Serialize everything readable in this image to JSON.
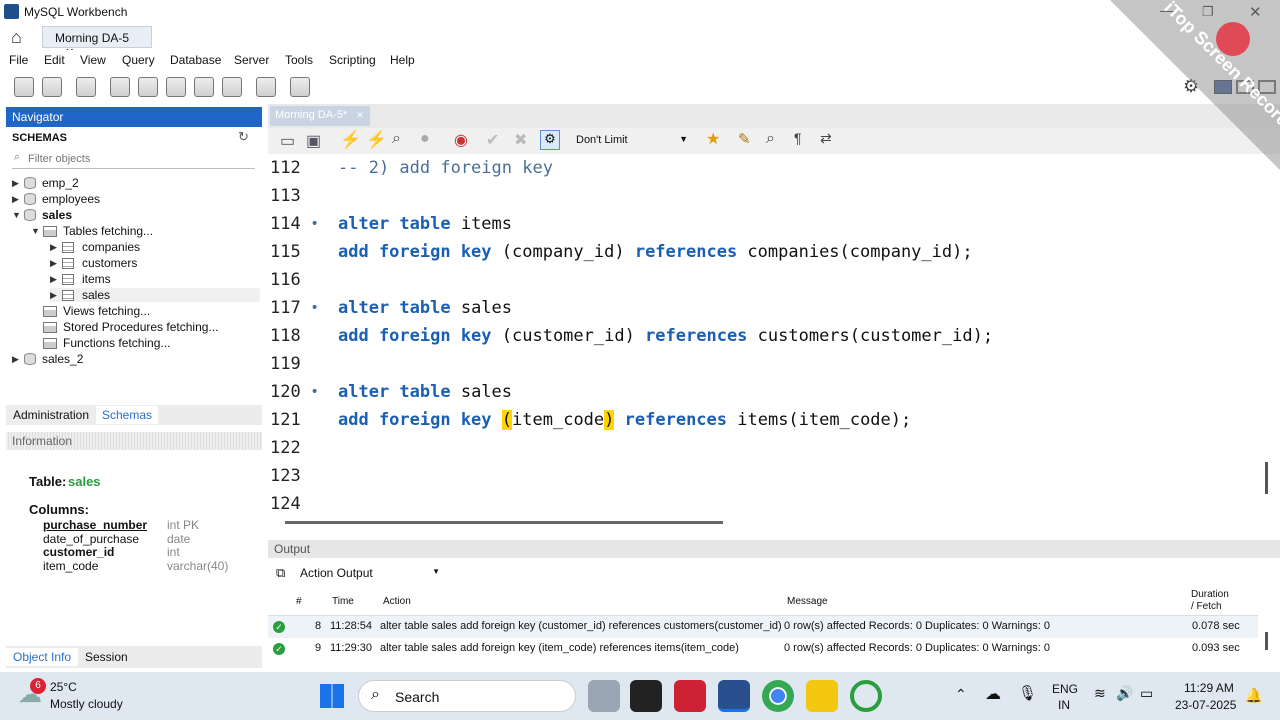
{
  "window": {
    "title": "MySQL Workbench",
    "tab_label": "Morning DA-5"
  },
  "watermark": {
    "text": "iTop Screen Recorder"
  },
  "menu": [
    "File",
    "Edit",
    "View",
    "Query",
    "Database",
    "Server",
    "Tools",
    "Scripting",
    "Help"
  ],
  "navigator": {
    "header": "Navigator",
    "schemas_label": "SCHEMAS",
    "filter_placeholder": "Filter objects",
    "tree": [
      {
        "label": "emp_2",
        "level": 0,
        "arrow": "▶",
        "kind": "db"
      },
      {
        "label": "employees",
        "level": 0,
        "arrow": "▶",
        "kind": "db"
      },
      {
        "label": "sales",
        "level": 0,
        "arrow": "▼",
        "kind": "db",
        "bold": true
      },
      {
        "label": "Tables fetching...",
        "level": 1,
        "arrow": "▼",
        "kind": "folder"
      },
      {
        "label": "companies",
        "level": 2,
        "arrow": "▶",
        "kind": "table"
      },
      {
        "label": "customers",
        "level": 2,
        "arrow": "▶",
        "kind": "table"
      },
      {
        "label": "items",
        "level": 2,
        "arrow": "▶",
        "kind": "table"
      },
      {
        "label": "sales",
        "level": 2,
        "arrow": "▶",
        "kind": "table",
        "selected": true
      },
      {
        "label": "Views fetching...",
        "level": 1,
        "arrow": "",
        "kind": "folder"
      },
      {
        "label": "Stored Procedures fetching...",
        "level": 1,
        "arrow": "",
        "kind": "folder"
      },
      {
        "label": "Functions fetching...",
        "level": 1,
        "arrow": "",
        "kind": "folder"
      },
      {
        "label": "sales_2",
        "level": 0,
        "arrow": "▶",
        "kind": "db"
      }
    ],
    "bottom_tabs": [
      "Administration",
      "Schemas"
    ]
  },
  "info": {
    "header": "Information",
    "table_label": "Table:",
    "table_name": "sales",
    "columns_label": "Columns:",
    "columns": [
      {
        "name": "purchase_number",
        "type": "int PK",
        "key": true
      },
      {
        "name": "date_of_purchase",
        "type": "date",
        "key": false
      },
      {
        "name": "customer_id",
        "type": "int",
        "key": true
      },
      {
        "name": "item_code",
        "type": "varchar(40)",
        "key": false
      }
    ],
    "bottom_tabs": [
      "Object Info",
      "Session"
    ]
  },
  "editor": {
    "tab_label": "Morning DA-5*",
    "limit_select": "Don't Limit",
    "lines": [
      {
        "n": "112",
        "dot": false,
        "parts": [
          {
            "t": "-- 2) add foreign key",
            "c": "cm"
          }
        ]
      },
      {
        "n": "113",
        "dot": false,
        "parts": []
      },
      {
        "n": "114",
        "dot": true,
        "parts": [
          {
            "t": "alter table",
            "c": "kw"
          },
          {
            "t": " items",
            "c": ""
          }
        ]
      },
      {
        "n": "115",
        "dot": false,
        "parts": [
          {
            "t": "add foreign key",
            "c": "kw"
          },
          {
            "t": " (company_id) ",
            "c": ""
          },
          {
            "t": "references",
            "c": "kw"
          },
          {
            "t": " companies(company_id);",
            "c": ""
          }
        ]
      },
      {
        "n": "116",
        "dot": false,
        "parts": []
      },
      {
        "n": "117",
        "dot": true,
        "parts": [
          {
            "t": "alter table",
            "c": "kw"
          },
          {
            "t": " sales",
            "c": ""
          }
        ]
      },
      {
        "n": "118",
        "dot": false,
        "parts": [
          {
            "t": "add foreign key",
            "c": "kw"
          },
          {
            "t": " (customer_id) ",
            "c": ""
          },
          {
            "t": "references",
            "c": "kw"
          },
          {
            "t": " customers(customer_id);",
            "c": ""
          }
        ]
      },
      {
        "n": "119",
        "dot": false,
        "parts": []
      },
      {
        "n": "120",
        "dot": true,
        "parts": [
          {
            "t": "alter table",
            "c": "kw"
          },
          {
            "t": " sales",
            "c": ""
          }
        ]
      },
      {
        "n": "121",
        "dot": false,
        "parts": [
          {
            "t": "add foreign key",
            "c": "kw"
          },
          {
            "t": " ",
            "c": ""
          },
          {
            "t": "(",
            "c": "hl"
          },
          {
            "t": "item_code",
            "c": ""
          },
          {
            "t": ")",
            "c": "hl"
          },
          {
            "t": " ",
            "c": ""
          },
          {
            "t": "references",
            "c": "kw"
          },
          {
            "t": " items(item_code);",
            "c": ""
          }
        ]
      },
      {
        "n": "122",
        "dot": false,
        "parts": []
      },
      {
        "n": "123",
        "dot": false,
        "parts": []
      },
      {
        "n": "124",
        "dot": false,
        "parts": []
      }
    ]
  },
  "output": {
    "header": "Output",
    "select": "Action Output",
    "columns": {
      "num": "#",
      "time": "Time",
      "action": "Action",
      "message": "Message",
      "duration_1": "Duration",
      "duration_2": "/ Fetch"
    },
    "rows": [
      {
        "num": "8",
        "time": "11:28:54",
        "action": "alter table sales add foreign key (customer_id) references customers(customer_id)",
        "message": "0 row(s) affected Records: 0  Duplicates: 0  Warnings: 0",
        "duration": "0.078 sec"
      },
      {
        "num": "9",
        "time": "11:29:30",
        "action": "alter table sales add foreign key (item_code) references items(item_code)",
        "message": "0 row(s) affected Records: 0  Duplicates: 0  Warnings: 0",
        "duration": "0.093 sec"
      }
    ]
  },
  "taskbar": {
    "weather_badge": "6",
    "temp": "25°C",
    "weather": "Mostly cloudy",
    "search": "Search",
    "lang_1": "ENG",
    "lang_2": "IN",
    "time": "11:29 AM",
    "date": "23-07-2025"
  },
  "colors": {
    "accent": "#1f66c7",
    "keyword": "#1a5fb4",
    "highlight": "#ffd400",
    "success": "#2a9d3c"
  }
}
